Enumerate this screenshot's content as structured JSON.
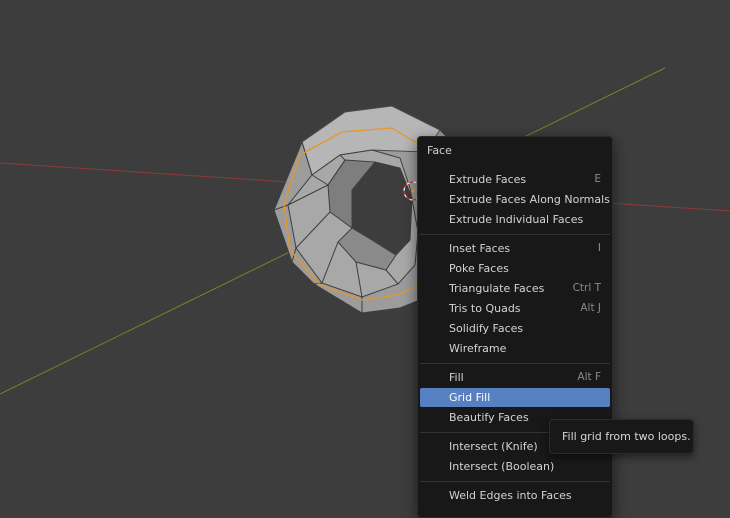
{
  "menu": {
    "title": "Face",
    "groups": [
      [
        {
          "label": "Extrude Faces",
          "shortcut": "E"
        },
        {
          "label": "Extrude Faces Along Normals",
          "shortcut": ""
        },
        {
          "label": "Extrude Individual Faces",
          "shortcut": ""
        }
      ],
      [
        {
          "label": "Inset Faces",
          "shortcut": "I"
        },
        {
          "label": "Poke Faces",
          "shortcut": ""
        },
        {
          "label": "Triangulate Faces",
          "shortcut": "Ctrl T"
        },
        {
          "label": "Tris to Quads",
          "shortcut": "Alt J"
        },
        {
          "label": "Solidify Faces",
          "shortcut": ""
        },
        {
          "label": "Wireframe",
          "shortcut": ""
        }
      ],
      [
        {
          "label": "Fill",
          "shortcut": "Alt F"
        },
        {
          "label": "Grid Fill",
          "shortcut": "",
          "active": true
        },
        {
          "label": "Beautify Faces",
          "shortcut": ""
        }
      ],
      [
        {
          "label": "Intersect (Knife)",
          "shortcut": ""
        },
        {
          "label": "Intersect (Boolean)",
          "shortcut": ""
        }
      ],
      [
        {
          "label": "Weld Edges into Faces",
          "shortcut": ""
        }
      ]
    ]
  },
  "tooltip": {
    "text": "Fill grid from two loops."
  },
  "colors": {
    "viewport_bg": "#3d3d3d",
    "menu_bg": "#181818",
    "highlight": "#5680c2",
    "x_axis": "#9c3c3c",
    "y_axis": "#6a8a2a",
    "selection_outline": "#e8962a"
  },
  "viewport": {
    "object": "mesh-ring",
    "cursor_icon": "3d-cursor-icon"
  }
}
